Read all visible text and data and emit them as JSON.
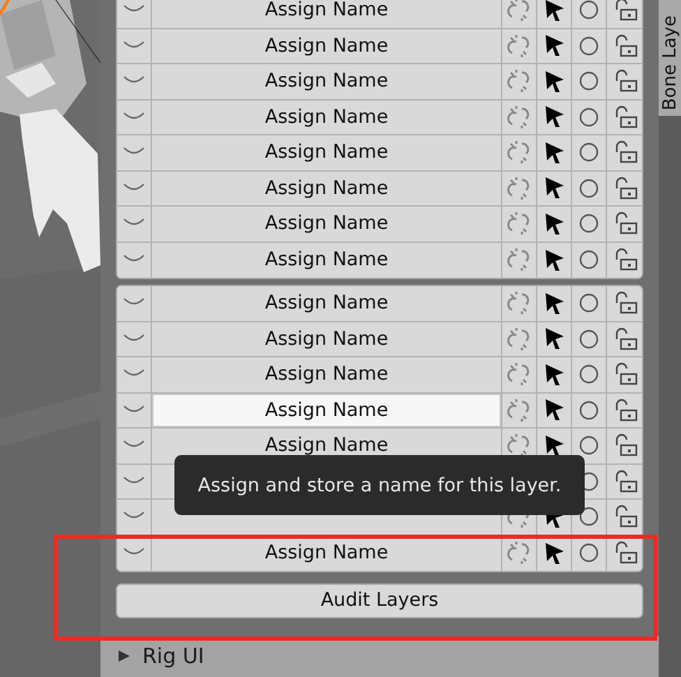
{
  "side_tab": {
    "label": "Bone Laye"
  },
  "layer_groups": [
    {
      "rows": [
        {
          "name": "Assign Name",
          "hovered": false
        },
        {
          "name": "Assign Name",
          "hovered": false
        },
        {
          "name": "Assign Name",
          "hovered": false
        },
        {
          "name": "Assign Name",
          "hovered": false
        },
        {
          "name": "Assign Name",
          "hovered": false
        },
        {
          "name": "Assign Name",
          "hovered": false
        },
        {
          "name": "Assign Name",
          "hovered": false
        },
        {
          "name": "Assign Name",
          "hovered": false
        }
      ]
    },
    {
      "rows": [
        {
          "name": "Assign Name",
          "hovered": false
        },
        {
          "name": "Assign Name",
          "hovered": false
        },
        {
          "name": "Assign Name",
          "hovered": false
        },
        {
          "name": "Assign Name",
          "hovered": true
        },
        {
          "name": "Assign Name",
          "hovered": false
        },
        {
          "hovered": false
        },
        {
          "hovered": false
        },
        {
          "name": "Assign Name",
          "hovered": false
        }
      ]
    }
  ],
  "audit_button": {
    "label": "Audit Layers"
  },
  "tooltip": {
    "text": "Assign and store a name for this layer."
  },
  "rig_ui_panel": {
    "label": "Rig UI",
    "expanded": false
  }
}
